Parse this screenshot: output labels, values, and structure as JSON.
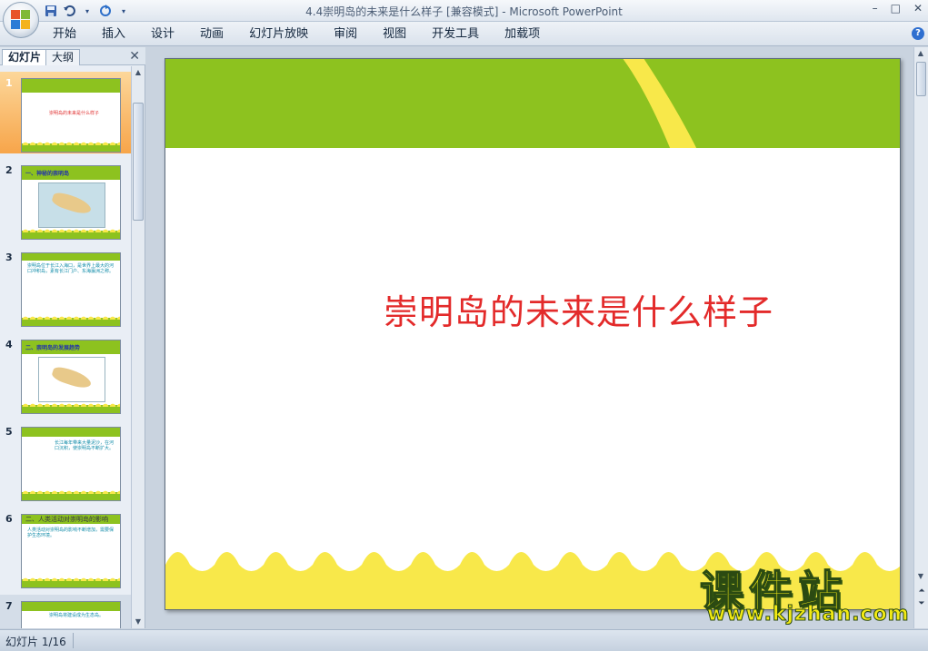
{
  "window": {
    "title": "4.4崇明岛的未来是什么样子 [兼容模式] - Microsoft PowerPoint",
    "controls": {
      "minimize": "–",
      "maximize": "□",
      "close": "✕"
    }
  },
  "quick_access": {
    "icons": [
      "save-icon",
      "undo-icon",
      "redo-icon",
      "customize-icon"
    ]
  },
  "ribbon": {
    "tabs": [
      "开始",
      "插入",
      "设计",
      "动画",
      "幻灯片放映",
      "审阅",
      "视图",
      "开发工具",
      "加载项"
    ],
    "help": "?"
  },
  "left_pane": {
    "tabs": {
      "slides": "幻灯片",
      "outline": "大纲"
    },
    "close": "✕",
    "thumbnails": [
      {
        "num": "1",
        "title": "",
        "text": "崇明岛的未来是什么样子",
        "selected": true
      },
      {
        "num": "2",
        "title": "一、神秘的崇明岛",
        "text": "",
        "selected": false
      },
      {
        "num": "3",
        "title": "",
        "text": "崇明岛位于长江入海口，是世界上最大的河口冲积岛，素有长江门户、东海瀛洲之称。",
        "selected": false
      },
      {
        "num": "4",
        "title": "二、崇明岛的发展趋势",
        "text": "崇明岛的发展趋势",
        "selected": false
      },
      {
        "num": "5",
        "title": "",
        "text": "长江每年带来大量泥沙，在河口沉积，使崇明岛不断扩大。",
        "selected": false
      },
      {
        "num": "6",
        "title": "二、人类活动对崇明岛的影响",
        "text": "人类活动对崇明岛的影响不断增加，需要保护生态环境。",
        "selected": false
      },
      {
        "num": "7",
        "title": "",
        "text": "崇明岛将建设成为生态岛。",
        "selected": false
      }
    ]
  },
  "slide": {
    "title": "崇明岛的未来是什么样子"
  },
  "watermark": {
    "cn": "课件站",
    "url": "www.kjzhan.com"
  },
  "status": {
    "slide_info": "幻灯片 1/16"
  },
  "colors": {
    "slide_green": "#8dc21f",
    "slide_yellow": "#f8e84a",
    "title_red": "#e32a2a"
  }
}
